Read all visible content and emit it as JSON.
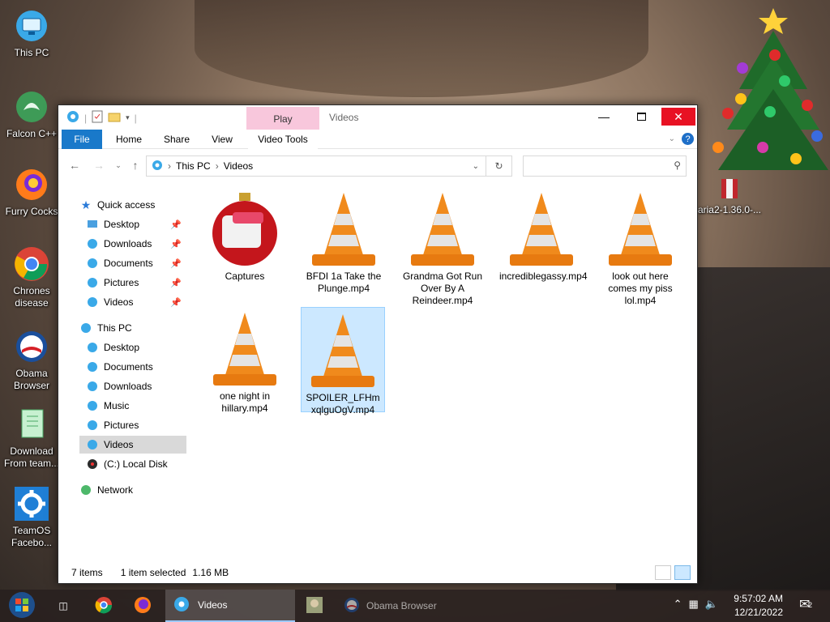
{
  "desktop": {
    "icons": [
      {
        "label": "This PC"
      },
      {
        "label": "Falcon C++"
      },
      {
        "label": "Furry Cocks"
      },
      {
        "label": "Chrones disease"
      },
      {
        "label": "Obama Browser"
      },
      {
        "label": "Download From team..."
      },
      {
        "label": "TeamOS Facebo..."
      }
    ],
    "partial_icon_label": "aria2-1.36.0-..."
  },
  "window": {
    "contextual_tab": "Play",
    "title": "Videos",
    "ribbon_tabs": [
      "File",
      "Home",
      "Share",
      "View",
      "Video Tools"
    ],
    "address": {
      "crumbs": [
        "This PC",
        "Videos"
      ]
    },
    "search_placeholder": ""
  },
  "nav": {
    "quick_access": {
      "label": "Quick access",
      "items": [
        "Desktop",
        "Downloads",
        "Documents",
        "Pictures",
        "Videos"
      ]
    },
    "this_pc": {
      "label": "This PC",
      "items": [
        "Desktop",
        "Documents",
        "Downloads",
        "Music",
        "Pictures",
        "Videos",
        "(C:) Local Disk"
      ]
    },
    "network": "Network"
  },
  "files": [
    {
      "name": "Captures",
      "type": "folder"
    },
    {
      "name": "BFDI 1a Take the Plunge.mp4",
      "type": "video"
    },
    {
      "name": "Grandma Got Run Over By A Reindeer.mp4",
      "type": "video"
    },
    {
      "name": "incrediblegassy.mp4",
      "type": "video"
    },
    {
      "name": "look out here comes my piss lol.mp4",
      "type": "video"
    },
    {
      "name": "one night in hillary.mp4",
      "type": "video"
    },
    {
      "name": "SPOILER_LFHmxqlguOgV.mp4",
      "type": "video",
      "selected": true
    }
  ],
  "status": {
    "count": "7 items",
    "selection": "1 item selected",
    "size": "1.16 MB"
  },
  "taskbar": {
    "explorer_label": "Videos",
    "browser_label": "Obama Browser",
    "time": "9:57:02 AM",
    "date": "12/21/2022",
    "notifications": "2"
  },
  "colors": {
    "file_tab": "#1979ca",
    "play_tab": "#f8c7dc",
    "selection": "#cce8ff",
    "close_button": "#e81123"
  }
}
